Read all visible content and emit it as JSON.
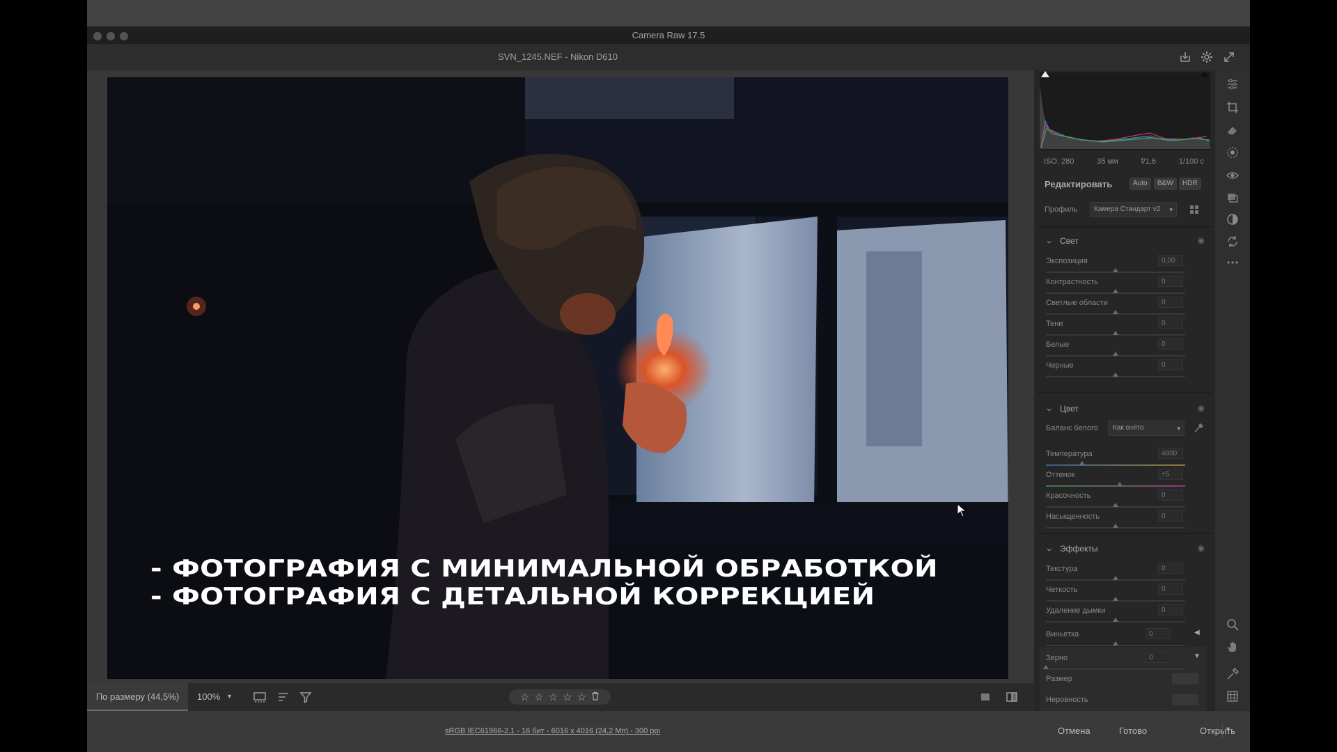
{
  "window": {
    "app_title": "Camera Raw 17.5",
    "file_title": "SVN_1245.NEF  -  Nikon D610"
  },
  "photo": {
    "overlay_line1": "- ФОТОГРАФИЯ С МИНИМАЛЬНОЙ ОБРАБОТКОЙ",
    "overlay_line2": "- ФОТОГРАФИЯ С ДЕТАЛЬНОЙ КОРРЕКЦИЕЙ"
  },
  "bottombar": {
    "fit_label": "По размеру (44,5%)",
    "zoom_value": "100%",
    "stars": [
      "☆",
      "☆",
      "☆",
      "☆",
      "☆"
    ],
    "trash_icon": "trash-icon"
  },
  "statusbar": {
    "workflow_link": "sRGB IEC61966-2.1 - 16 бит - 6016 x 4016 (24,2 Мп) - 300 ppi",
    "cancel_label": "Отмена",
    "done_label": "Готово",
    "open_label": "Открыть"
  },
  "histogram": {
    "iso": "ISO: 280",
    "focal": "35 мм",
    "aperture": "f/1,6",
    "shutter": "1/100 с"
  },
  "edit": {
    "title": "Редактировать",
    "auto_label": "Auto",
    "bw_label": "B&W",
    "hdr_label": "HDR",
    "profile_label": "Профиль",
    "profile_value": "Камера Стандарт v2"
  },
  "light": {
    "title": "Свет",
    "sliders": [
      {
        "label": "Экспозиция",
        "value": "0,00",
        "position": 0.5
      },
      {
        "label": "Контрастность",
        "value": "0",
        "position": 0.5
      },
      {
        "label": "Светлые области",
        "value": "0",
        "position": 0.5
      },
      {
        "label": "Тени",
        "value": "0",
        "position": 0.5
      },
      {
        "label": "Белые",
        "value": "0",
        "position": 0.5
      },
      {
        "label": "Черные",
        "value": "0",
        "position": 0.5
      }
    ]
  },
  "color": {
    "title": "Цвет",
    "wb_label": "Баланс белого",
    "wb_value": "Как снято",
    "sliders": [
      {
        "label": "Температура",
        "value": "4800",
        "position": 0.26
      },
      {
        "label": "Оттенок",
        "value": "+5",
        "position": 0.53
      },
      {
        "label": "Красочность",
        "value": "0",
        "position": 0.5
      },
      {
        "label": "Насыщенность",
        "value": "0",
        "position": 0.5
      }
    ]
  },
  "effects": {
    "title": "Эффекты",
    "sliders": [
      {
        "label": "Текстура",
        "value": "0",
        "position": 0.5
      },
      {
        "label": "Четкость",
        "value": "0",
        "position": 0.5
      },
      {
        "label": "Удаление дымки",
        "value": "0",
        "position": 0.5
      },
      {
        "label": "Виньетка",
        "value": "0",
        "position": 0.5
      },
      {
        "label": "Зерно",
        "value": "0",
        "position": 0.0
      },
      {
        "label": "Размер",
        "value": "",
        "position": null
      },
      {
        "label": "Неровность",
        "value": "",
        "position": null
      }
    ]
  },
  "colors": {
    "accent": "#6b6b6b",
    "panel_bg": "#262626"
  }
}
